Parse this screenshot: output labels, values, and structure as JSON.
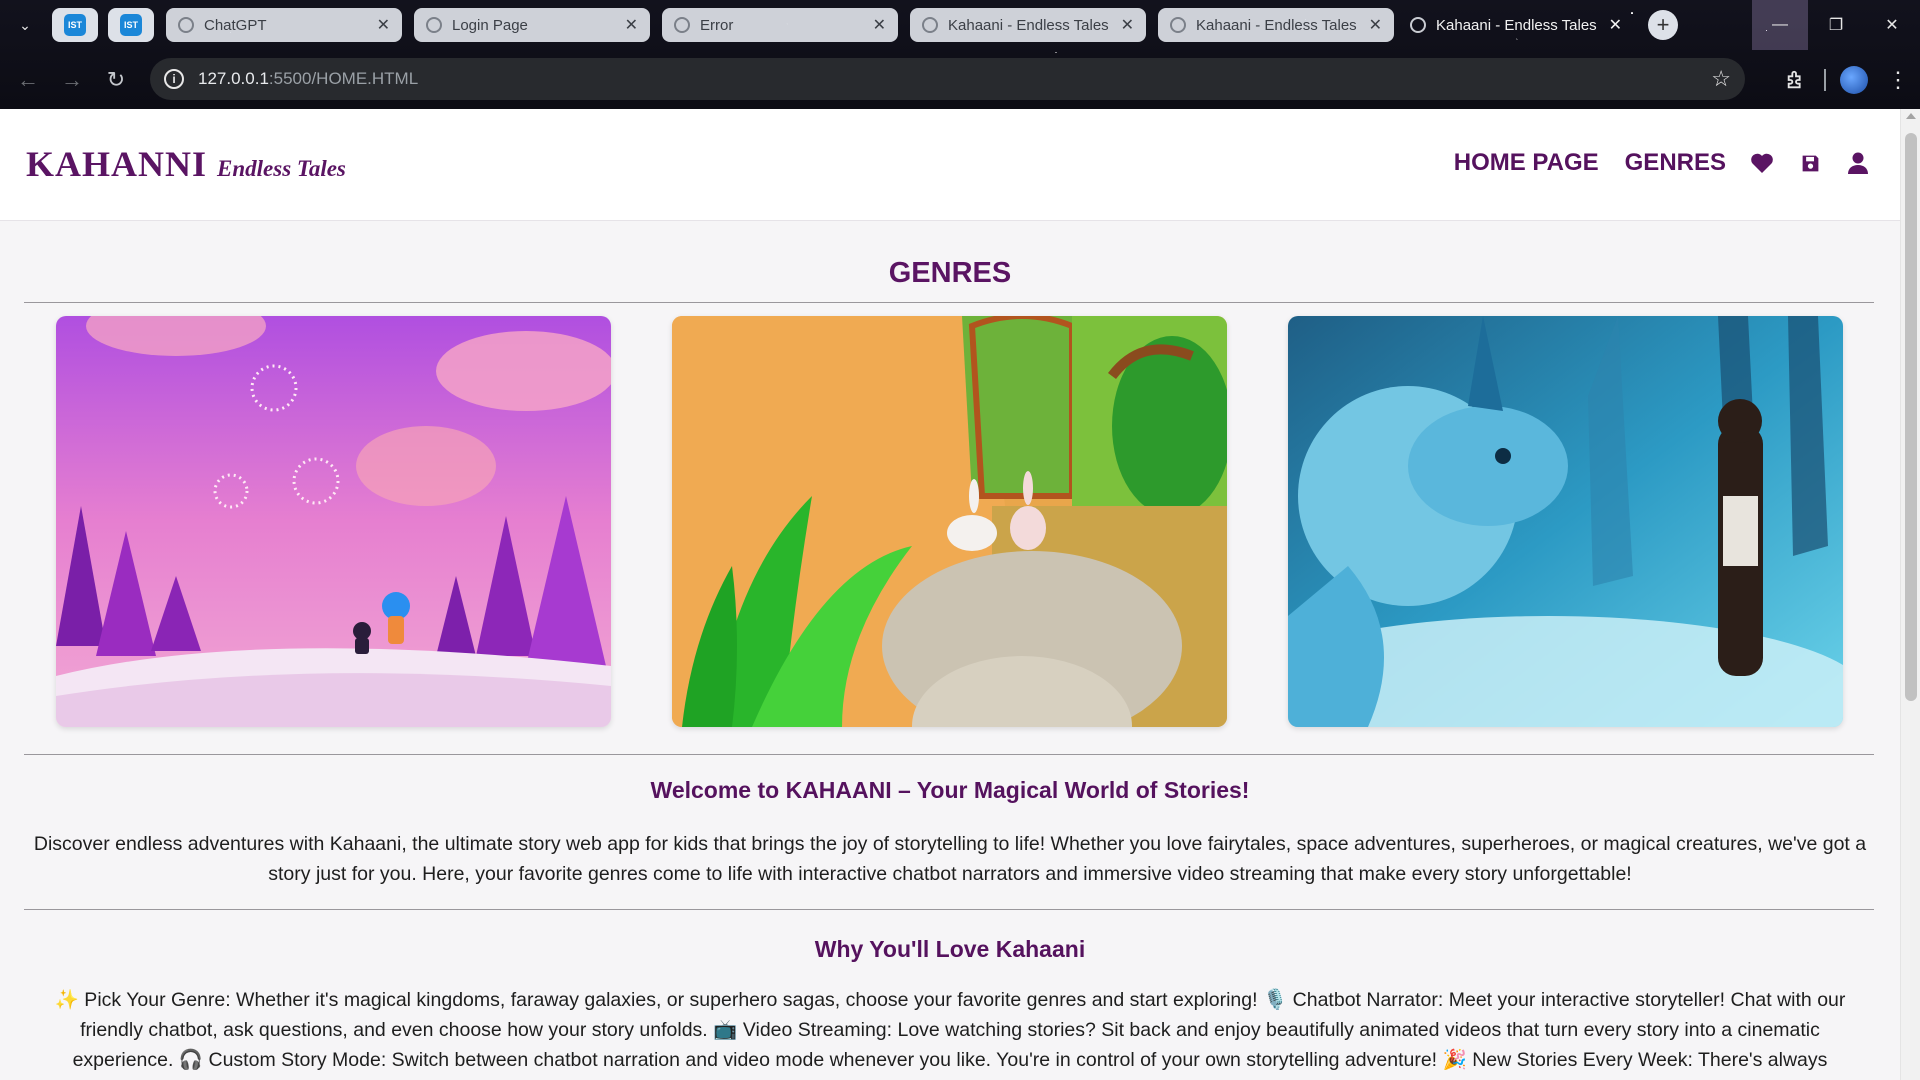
{
  "browser": {
    "pinned_tabs": [
      {
        "label": "IST"
      },
      {
        "label": "IST"
      }
    ],
    "tabs": [
      {
        "title": "ChatGPT",
        "close": "✕"
      },
      {
        "title": "Login Page",
        "close": "✕"
      },
      {
        "title": "Error",
        "close": "✕"
      },
      {
        "title": "Kahaani - Endless Tales",
        "close": "✕"
      },
      {
        "title": "Kahaani - Endless Tales",
        "close": "✕"
      },
      {
        "title": "Kahaani - Endless Tales",
        "close": "✕",
        "active": true
      }
    ],
    "new_tab": "+",
    "url_host": "127.0.0.1",
    "url_path": ":5500/HOME.HTML"
  },
  "header": {
    "logo_main": "KAHANNI",
    "logo_tagline": "Endless Tales",
    "nav": {
      "home": "HOME PAGE",
      "genres": "GENRES"
    },
    "icons": [
      "heart-icon",
      "save-icon",
      "user-icon"
    ]
  },
  "main": {
    "genres_heading": "GENRES",
    "cards": [
      {
        "name": "fairy-night-scene"
      },
      {
        "name": "bunnies-forest-scene"
      },
      {
        "name": "dragon-hero-scene"
      }
    ],
    "welcome_heading": "Welcome to KAHAANI – Your Magical World of Stories!",
    "welcome_text": "Discover endless adventures with Kahaani, the ultimate story web app for kids that brings the joy of storytelling to life! Whether you love fairytales, space adventures, superheroes, or magical creatures, we've got a story just for you. Here, your favorite genres come to life with interactive chatbot narrators and immersive video streaming that make every story unforgettable!",
    "why_heading": "Why You'll Love Kahaani",
    "why_text": "✨ Pick Your Genre: Whether it's magical kingdoms, faraway galaxies, or superhero sagas, choose your favorite genres and start exploring! 🎙️ Chatbot Narrator: Meet your interactive storyteller! Chat with our friendly chatbot, ask questions, and even choose how your story unfolds. 📺 Video Streaming: Love watching stories? Sit back and enjoy beautifully animated videos that turn every story into a cinematic experience. 🎧 Custom Story Mode: Switch between chatbot narration and video mode whenever you like. You're in control of your own storytelling adventure! 🎉 New Stories Every Week: There's always"
  },
  "colors": {
    "brand": "#5a1463",
    "page_bg": "#f6f5f7"
  }
}
